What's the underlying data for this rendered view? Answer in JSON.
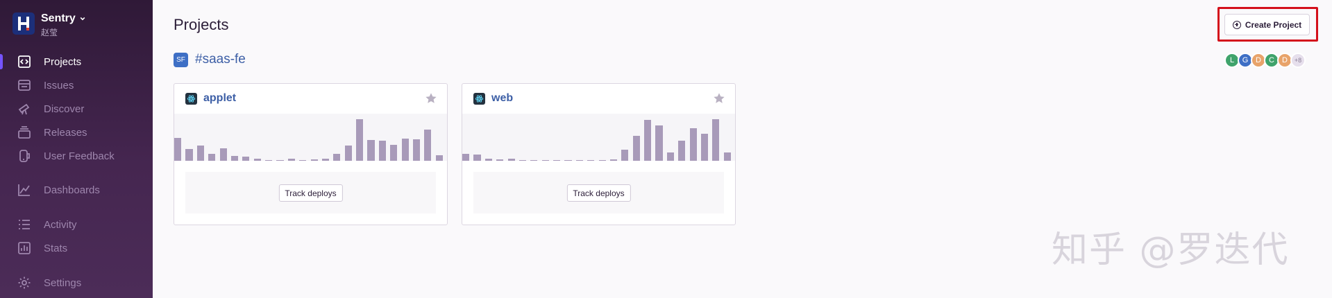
{
  "sidebar": {
    "org_name": "Sentry",
    "org_subtitle": "赵莹",
    "items": [
      {
        "label": "Projects",
        "icon": "code-icon",
        "active": true
      },
      {
        "label": "Issues",
        "icon": "inbox-icon"
      },
      {
        "label": "Discover",
        "icon": "telescope-icon"
      },
      {
        "label": "Releases",
        "icon": "stack-icon"
      },
      {
        "label": "User Feedback",
        "icon": "megaphone-icon"
      },
      {
        "label": "Dashboards",
        "icon": "graph-icon"
      },
      {
        "label": "Activity",
        "icon": "list-icon"
      },
      {
        "label": "Stats",
        "icon": "bar-chart-icon"
      },
      {
        "label": "Settings",
        "icon": "gear-icon"
      }
    ]
  },
  "header": {
    "title": "Projects",
    "create_button_label": "Create Project"
  },
  "team": {
    "badge": "SF",
    "name": "#saas-fe",
    "members": [
      {
        "initial": "L",
        "color": "#3fa36b"
      },
      {
        "initial": "G",
        "color": "#3e6fc5"
      },
      {
        "initial": "D",
        "color": "#e8a36a"
      },
      {
        "initial": "C",
        "color": "#3fa36b"
      },
      {
        "initial": "D",
        "color": "#e8a36a"
      }
    ],
    "more_count": "+8"
  },
  "projects": [
    {
      "name": "applet",
      "track_label": "Track deploys",
      "stats": [
        0.49,
        0.25,
        0.32,
        0.14,
        0.27,
        0.11,
        0.09,
        0.05,
        0.02,
        0.02,
        0.04,
        0.02,
        0.03,
        0.05,
        0.15,
        0.33,
        0.88,
        0.44,
        0.42,
        0.34,
        0.47,
        0.45,
        0.66,
        0.12
      ]
    },
    {
      "name": "web",
      "track_label": "Track deploys",
      "stats": [
        0.15,
        0.13,
        0.04,
        0.03,
        0.05,
        0.02,
        0.02,
        0.02,
        0.02,
        0.02,
        0.02,
        0.02,
        0.02,
        0.03,
        0.24,
        0.53,
        0.87,
        0.75,
        0.18,
        0.42,
        0.69,
        0.57,
        0.88,
        0.18
      ]
    }
  ],
  "watermark": "知乎 @罗迭代",
  "colors": {
    "accent": "#7553ff",
    "highlight": "#d4101b",
    "bar": "#a89ab9"
  }
}
